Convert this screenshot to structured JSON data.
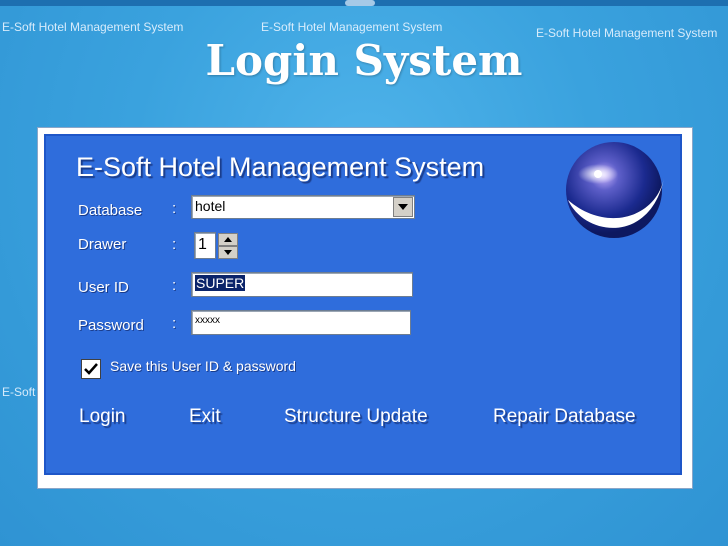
{
  "watermark": "E-Soft Hotel Management System",
  "watermark_short": "E-Soft H",
  "slide_title": "Login System",
  "dialog": {
    "app_title": "E-Soft Hotel Management System",
    "colon": ":",
    "database": {
      "label": "Database",
      "value": "hotel"
    },
    "drawer": {
      "label": "Drawer",
      "value": "1"
    },
    "user_id": {
      "label": "User ID",
      "value": "SUPER"
    },
    "password": {
      "label": "Password",
      "value": "xxxxx"
    },
    "remember": {
      "label": "Save this User ID & password",
      "checked": true
    },
    "actions": {
      "login": "Login",
      "exit": "Exit",
      "structure_update": "Structure Update",
      "repair_database": "Repair Database"
    }
  },
  "colors": {
    "background": "#3aa2de",
    "dialog": "#2f6ddc",
    "text": "#ffffff",
    "selection": "#0a246a"
  }
}
